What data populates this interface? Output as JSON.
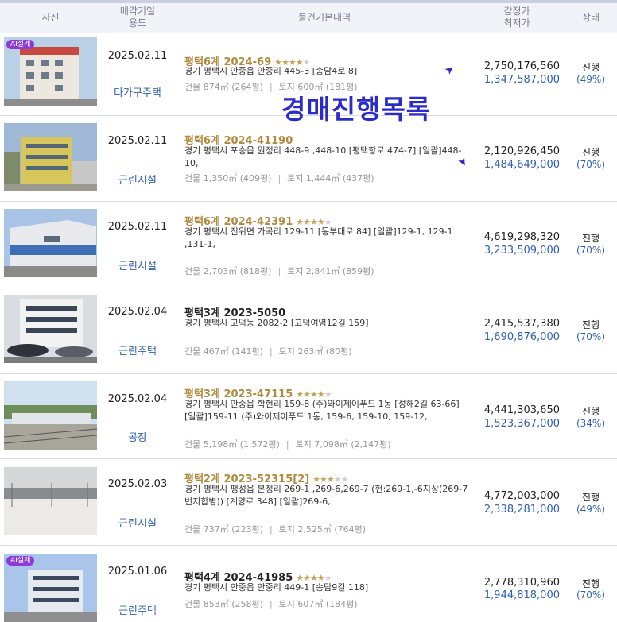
{
  "header": {
    "photo": "사진",
    "date_line1": "매각기일",
    "date_line2": "용도",
    "info": "물건기본내역",
    "price_line1": "감정가",
    "price_line2": "최저가",
    "status": "상태"
  },
  "overlay": {
    "title": "경매진행목록",
    "ai_badge": "AI설계"
  },
  "listings": [
    {
      "date": "2025.02.11",
      "use": "다가구주택",
      "case": "평택6계 2024-69",
      "stars": "★★★★",
      "stars_off": "★",
      "address": "경기 평택시 안중읍 안중리 445-3 [송담4로 8]",
      "building": "건물 874㎡ (264평)",
      "land": "토지 600㎡ (181평)",
      "appraisal": "2,750,176,560",
      "min_price": "1,347,587,000",
      "status": "진행",
      "ratio": "(49%)"
    },
    {
      "date": "2025.02.11",
      "use": "근린시설",
      "case": "평택6계 2024-41190",
      "stars": "",
      "stars_off": "",
      "address": "경기 평택시 포승읍 원정리 448-9 ,448-10 [평택항로 474-7] [일괄]448-10,",
      "building": "건물 1,350㎡ (409평)",
      "land": "토지 1,444㎡ (437평)",
      "appraisal": "2,120,926,450",
      "min_price": "1,484,649,000",
      "status": "진행",
      "ratio": "(70%)"
    },
    {
      "date": "2025.02.11",
      "use": "근린시설",
      "case": "평택6계 2024-42391",
      "stars": "★★★★",
      "stars_off": "★",
      "address": "경기 평택시 진위면 가곡리 129-11 [동부대로 84] [일괄]129-1, 129-1 ,131-1,",
      "building": "건물 2,703㎡ (818평)",
      "land": "토지 2,841㎡ (859평)",
      "appraisal": "4,619,298,320",
      "min_price": "3,233,509,000",
      "status": "진행",
      "ratio": "(70%)"
    },
    {
      "date": "2025.02.04",
      "use": "근린주택",
      "case": "평택3계 2023-5050",
      "stars": "",
      "stars_off": "",
      "address": "경기 평택시 고덕동 2082-2 [고덕여염12길 159]",
      "building": "건물 467㎡ (141평)",
      "land": "토지 263㎡ (80평)",
      "appraisal": "2,415,537,380",
      "min_price": "1,690,876,000",
      "status": "진행",
      "ratio": "(70%)"
    },
    {
      "date": "2025.02.04",
      "use": "공장",
      "case": "평택3계 2023-47115",
      "stars": "★★★★",
      "stars_off": "★",
      "address": "경기 평택시 안중읍 학현리 159-8 (주)와이제이푸드 1동 [성해2길 63-66] [일괄]159-11 (주)와이제이푸드 1동, 159-6, 159-10, 159-12,",
      "building": "건물 5,198㎡ (1,572평)",
      "land": "토지 7,098㎡ (2,147평)",
      "appraisal": "4,441,303,650",
      "min_price": "1,523,367,000",
      "status": "진행",
      "ratio": "(34%)"
    },
    {
      "date": "2025.02.03",
      "use": "근린시설",
      "case": "평택2계 2023-52315[2]",
      "stars": "★★★",
      "stars_off": "★★",
      "address": "경기 평택시 팽성읍 본정리 269-1 ,269-6,269-7 (현:269-1,-6지상(269-7번지합병)) [계양로 348] [일괄]269-6,",
      "building": "건물 737㎡ (223평)",
      "land": "토지 2,525㎡ (764평)",
      "appraisal": "4,772,003,000",
      "min_price": "2,338,281,000",
      "status": "진행",
      "ratio": "(49%)"
    },
    {
      "date": "2025.01.06",
      "use": "근린주택",
      "case": "평택4계 2024-41985",
      "stars": "★★★★",
      "stars_off": "★",
      "address": "경기 평택시 안중읍 안중리 449-1 [송담9길 118]",
      "building": "건물 853㎡ (258평)",
      "land": "토지 607㎡ (184평)",
      "appraisal": "2,778,310,960",
      "min_price": "1,944,818,000",
      "status": "진행",
      "ratio": "(70%)"
    }
  ]
}
